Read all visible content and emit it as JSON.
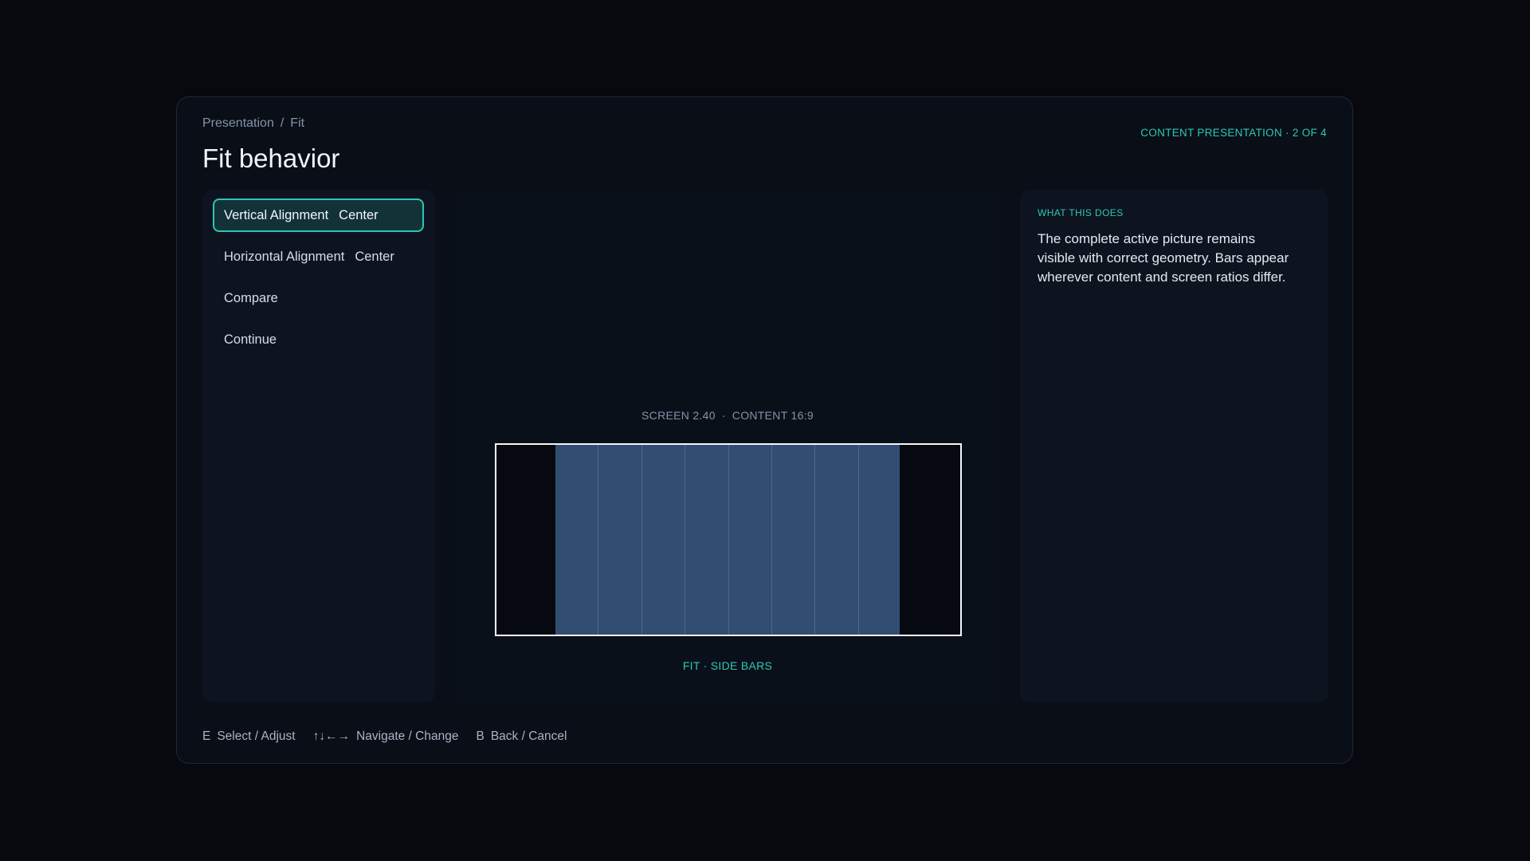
{
  "breadcrumb": {
    "parent": "Presentation",
    "separator": "/",
    "current": "Fit"
  },
  "page_title": "Fit behavior",
  "progress_label": "CONTENT PRESENTATION · 2 OF 4",
  "menu": {
    "items": [
      {
        "label": "Vertical Alignment",
        "value": "Center",
        "selected": true
      },
      {
        "label": "Horizontal Alignment",
        "value": "Center",
        "selected": false
      },
      {
        "label": "Compare",
        "value": "",
        "selected": false
      },
      {
        "label": "Continue",
        "value": "",
        "selected": false
      }
    ]
  },
  "preview": {
    "screen_label": "SCREEN 2.40",
    "separator": "·",
    "content_label": "CONTENT 16:9",
    "fit_label": "FIT · SIDE BARS",
    "stripe_count": 8
  },
  "info": {
    "heading": "WHAT THIS DOES",
    "body": "The complete active picture remains visible with correct geometry. Bars appear wherever content and screen ratios differ."
  },
  "footer": {
    "hints": [
      {
        "key": "E",
        "action": "Select / Adjust"
      },
      {
        "key": "↑↓←→",
        "action": "Navigate / Change"
      },
      {
        "key": "B",
        "action": "Back / Cancel"
      }
    ]
  },
  "colors": {
    "accent": "#2fc7b4",
    "background": "#07090f",
    "panel": "#090e17",
    "content_fill": "#324d72"
  }
}
